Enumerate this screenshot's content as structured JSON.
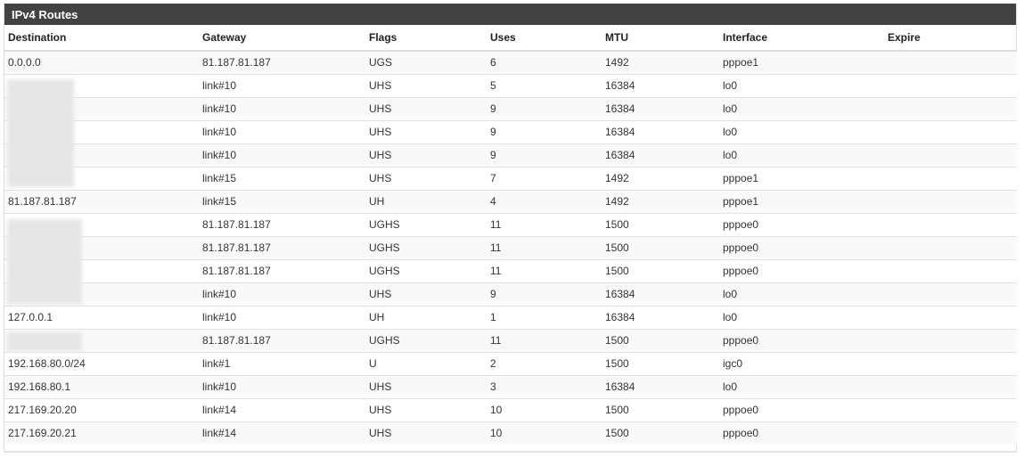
{
  "panel": {
    "title": "IPv4 Routes"
  },
  "table": {
    "headers": {
      "destination": "Destination",
      "gateway": "Gateway",
      "flags": "Flags",
      "uses": "Uses",
      "mtu": "MTU",
      "interface": "Interface",
      "expire": "Expire"
    },
    "rows": [
      {
        "destination": "0.0.0.0",
        "gateway": "81.187.81.187",
        "flags": "UGS",
        "uses": "6",
        "mtu": "1492",
        "interface": "pppoe1",
        "expire": ""
      },
      {
        "destination": "",
        "gateway": "link#10",
        "flags": "UHS",
        "uses": "5",
        "mtu": "16384",
        "interface": "lo0",
        "expire": ""
      },
      {
        "destination": "",
        "gateway": "link#10",
        "flags": "UHS",
        "uses": "9",
        "mtu": "16384",
        "interface": "lo0",
        "expire": ""
      },
      {
        "destination": "",
        "gateway": "link#10",
        "flags": "UHS",
        "uses": "9",
        "mtu": "16384",
        "interface": "lo0",
        "expire": ""
      },
      {
        "destination": "",
        "gateway": "link#10",
        "flags": "UHS",
        "uses": "9",
        "mtu": "16384",
        "interface": "lo0",
        "expire": ""
      },
      {
        "destination": "",
        "gateway": "link#15",
        "flags": "UHS",
        "uses": "7",
        "mtu": "1492",
        "interface": "pppoe1",
        "expire": ""
      },
      {
        "destination": "81.187.81.187",
        "gateway": "link#15",
        "flags": "UH",
        "uses": "4",
        "mtu": "1492",
        "interface": "pppoe1",
        "expire": ""
      },
      {
        "destination": "",
        "gateway": "81.187.81.187",
        "flags": "UGHS",
        "uses": "11",
        "mtu": "1500",
        "interface": "pppoe0",
        "expire": ""
      },
      {
        "destination": "",
        "gateway": "81.187.81.187",
        "flags": "UGHS",
        "uses": "11",
        "mtu": "1500",
        "interface": "pppoe0",
        "expire": ""
      },
      {
        "destination": "",
        "gateway": "81.187.81.187",
        "flags": "UGHS",
        "uses": "11",
        "mtu": "1500",
        "interface": "pppoe0",
        "expire": ""
      },
      {
        "destination": "",
        "gateway": "link#10",
        "flags": "UHS",
        "uses": "9",
        "mtu": "16384",
        "interface": "lo0",
        "expire": ""
      },
      {
        "destination": "127.0.0.1",
        "gateway": "link#10",
        "flags": "UH",
        "uses": "1",
        "mtu": "16384",
        "interface": "lo0",
        "expire": ""
      },
      {
        "destination": "",
        "gateway": "81.187.81.187",
        "flags": "UGHS",
        "uses": "11",
        "mtu": "1500",
        "interface": "pppoe0",
        "expire": ""
      },
      {
        "destination": "192.168.80.0/24",
        "gateway": "link#1",
        "flags": "U",
        "uses": "2",
        "mtu": "1500",
        "interface": "igc0",
        "expire": ""
      },
      {
        "destination": "192.168.80.1",
        "gateway": "link#10",
        "flags": "UHS",
        "uses": "3",
        "mtu": "16384",
        "interface": "lo0",
        "expire": ""
      },
      {
        "destination": "217.169.20.20",
        "gateway": "link#14",
        "flags": "UHS",
        "uses": "10",
        "mtu": "1500",
        "interface": "pppoe0",
        "expire": ""
      },
      {
        "destination": "217.169.20.21",
        "gateway": "link#14",
        "flags": "UHS",
        "uses": "10",
        "mtu": "1500",
        "interface": "pppoe0",
        "expire": ""
      }
    ]
  },
  "colors": {
    "heading_bg": "#424242",
    "heading_text": "#ffffff",
    "row_alt_bg": "#f9f9f9",
    "border": "#dddddd"
  }
}
